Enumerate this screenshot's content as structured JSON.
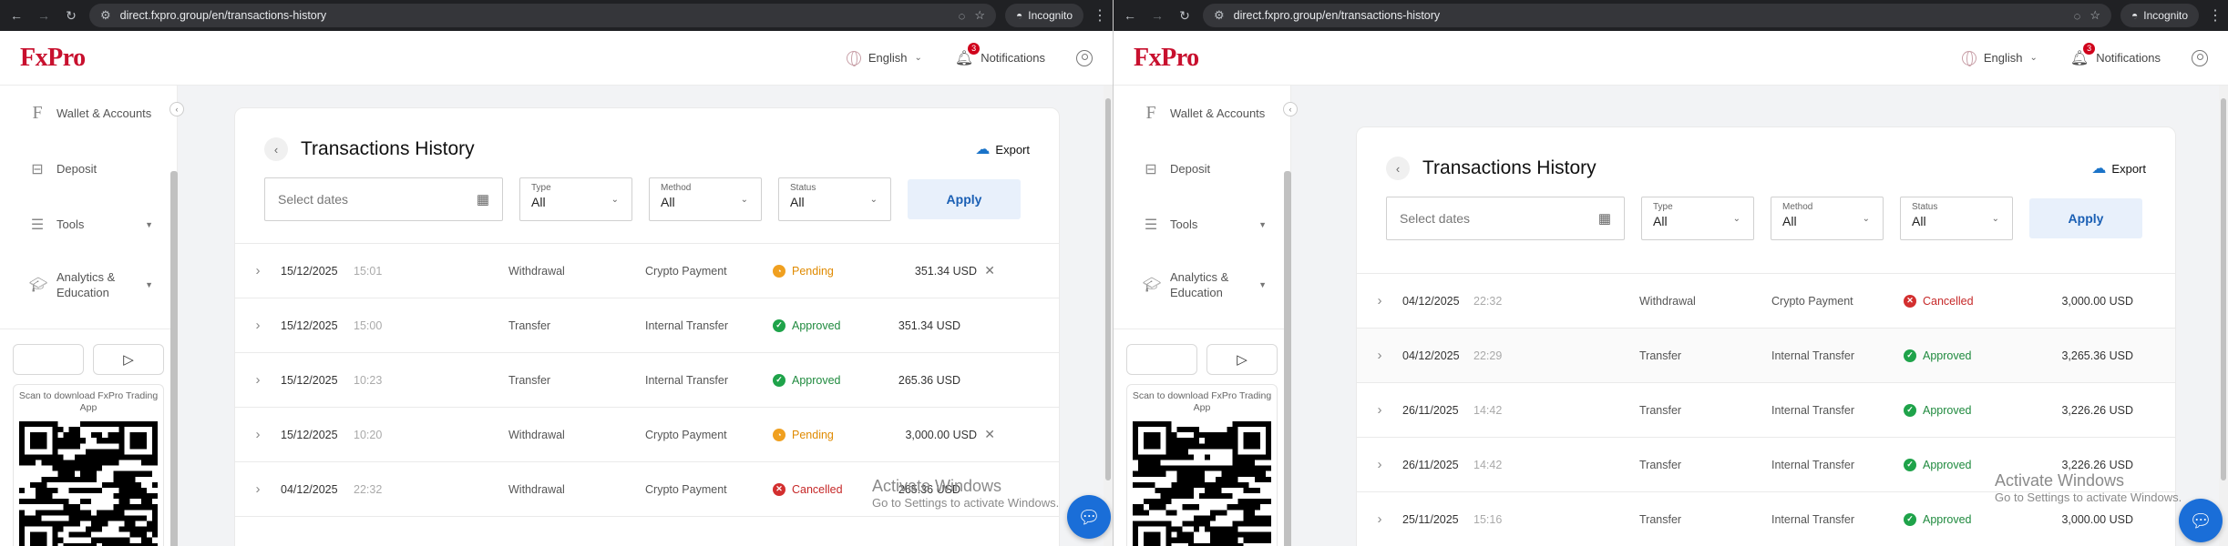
{
  "browser": {
    "url": "direct.fxpro.group/en/transactions-history",
    "incognito_label": "Incognito"
  },
  "header": {
    "logo": "FxPro",
    "language": "English",
    "notifications_label": "Notifications",
    "notifications_count": "3"
  },
  "sidebar": {
    "items": [
      {
        "label": "Wallet & Accounts",
        "icon": "wallet-icon"
      },
      {
        "label": "Deposit",
        "icon": "deposit-icon"
      },
      {
        "label": "Tools",
        "icon": "tools-icon"
      },
      {
        "label": "Analytics & Education",
        "icon": "education-icon"
      }
    ],
    "qr_text": "Scan to download FxPro Trading App"
  },
  "page": {
    "title": "Transactions History",
    "export_label": "Export",
    "date_placeholder": "Select dates",
    "filters": [
      {
        "label": "Type",
        "value": "All"
      },
      {
        "label": "Method",
        "value": "All"
      },
      {
        "label": "Status",
        "value": "All"
      }
    ],
    "apply_label": "Apply"
  },
  "screens": [
    {
      "rows": [
        {
          "date": "15/12/2025",
          "time": "15:01",
          "type": "Withdrawal",
          "method": "Crypto Payment",
          "status": "Pending",
          "amount": "351.34 USD",
          "cancellable": true
        },
        {
          "date": "15/12/2025",
          "time": "15:00",
          "type": "Transfer",
          "method": "Internal Transfer",
          "status": "Approved",
          "amount": "351.34 USD",
          "cancellable": false
        },
        {
          "date": "15/12/2025",
          "time": "10:23",
          "type": "Transfer",
          "method": "Internal Transfer",
          "status": "Approved",
          "amount": "265.36 USD",
          "cancellable": false
        },
        {
          "date": "15/12/2025",
          "time": "10:20",
          "type": "Withdrawal",
          "method": "Crypto Payment",
          "status": "Pending",
          "amount": "3,000.00 USD",
          "cancellable": true
        },
        {
          "date": "04/12/2025",
          "time": "22:32",
          "type": "Withdrawal",
          "method": "Crypto Payment",
          "status": "Cancelled",
          "amount": "265.36 USD",
          "cancellable": false
        }
      ]
    },
    {
      "rows": [
        {
          "date": "04/12/2025",
          "time": "22:32",
          "type": "Withdrawal",
          "method": "Crypto Payment",
          "status": "Cancelled",
          "amount": "3,000.00 USD",
          "cancellable": false
        },
        {
          "date": "04/12/2025",
          "time": "22:29",
          "type": "Transfer",
          "method": "Internal Transfer",
          "status": "Approved",
          "amount": "3,265.36 USD",
          "cancellable": false
        },
        {
          "date": "26/11/2025",
          "time": "14:42",
          "type": "Transfer",
          "method": "Internal Transfer",
          "status": "Approved",
          "amount": "3,226.26 USD",
          "cancellable": false
        },
        {
          "date": "26/11/2025",
          "time": "14:42",
          "type": "Transfer",
          "method": "Internal Transfer",
          "status": "Approved",
          "amount": "3,226.26 USD",
          "cancellable": false
        },
        {
          "date": "25/11/2025",
          "time": "15:16",
          "type": "Transfer",
          "method": "Internal Transfer",
          "status": "Approved",
          "amount": "3,000.00 USD",
          "cancellable": false
        }
      ]
    }
  ],
  "watermark": {
    "line1": "Activate Windows",
    "line2": "Go to Settings to activate Windows."
  },
  "colors": {
    "brand": "#c8102e",
    "accent": "#1a6ed8",
    "approved": "#1fa34a",
    "pending": "#f0a020",
    "cancelled": "#d32f2f"
  }
}
